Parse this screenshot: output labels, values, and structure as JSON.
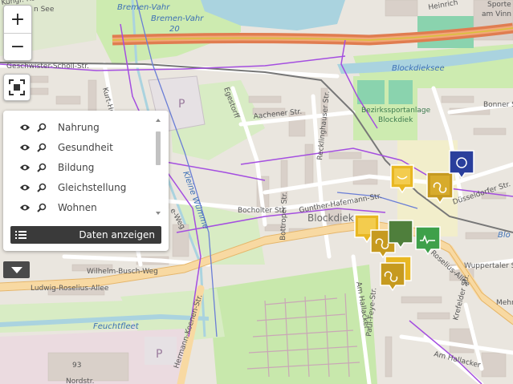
{
  "controls": {
    "zoom_in": "+",
    "zoom_out": "−"
  },
  "panel": {
    "items": [
      {
        "label": "Nahrung"
      },
      {
        "label": "Gesundheit"
      },
      {
        "label": "Bildung"
      },
      {
        "label": "Gleichstellung"
      },
      {
        "label": "Wohnen"
      }
    ],
    "data_button": "Daten anzeigen"
  },
  "map": {
    "labels": {
      "kuhgrabensee": "Kuhgr. Rose",
      "see": "n See",
      "bremen_vahr_1": "Bremen-Vahr",
      "bremen_vahr_2": "Bremen-Vahr",
      "route_20": "20",
      "heinrich": "Heinrich",
      "sport": "Sporte",
      "am_vinn": "am Vinn",
      "scholl": "Geschwister-Scholl-Str.",
      "kurt": "Kurt-Hub",
      "blockdieksee": "Blockdieksee",
      "bonner": "Bonner St",
      "bezirk1": "Bezirkssportanlage",
      "bezirk2": "Blockdiek",
      "egestorff": "Egestorff",
      "aachener": "Aachener Str.",
      "recklinghauser": "Recklinghauser Str.",
      "duesseldorfer": "Düsseldorfer Str.",
      "bocholter": "Bocholter Str.",
      "bottroper": "Bottroper Str.",
      "gunther": "Gunther-Hafemann-Str.",
      "blockdiek": "Blockdiek",
      "klein": "Kleine Wümme",
      "weg": "e-Weg",
      "wilhelm": "Wilhelm-Busch-Weg",
      "ludwig": "Ludwig-Roselius-Allee",
      "roselius": "Roselius-Allee",
      "wuppertaler": "Wuppertaler Str.",
      "feuchtfleet": "Feuchtfleet",
      "hermann": "Hermann-Koenen-Str.",
      "am_hallacker_v": "Am Hallacker",
      "paul": "Paul-Feye-Str.",
      "am_hallacker": "Am Hallacker",
      "krefelder": "Krefelder Str.",
      "mehr": "Mehr",
      "num93": "93",
      "nordstr": "Nordstr.",
      "blo": "Blo",
      "parking": "P",
      "parking2": "P"
    }
  },
  "colors": {
    "sdg_gold": "#e8b722",
    "sdg_ochre": "#c69a1f",
    "sdg_green": "#3ea04a",
    "sdg_blue": "#2a3f9c",
    "road_orange": "#e88a5a",
    "tram_purple": "#a44ee0"
  },
  "icons": [
    "zoom-in-icon",
    "zoom-out-icon",
    "fullscreen-icon",
    "eye-icon",
    "magnifier-icon",
    "list-icon",
    "chevron-down-icon",
    "map-marker-icon"
  ]
}
